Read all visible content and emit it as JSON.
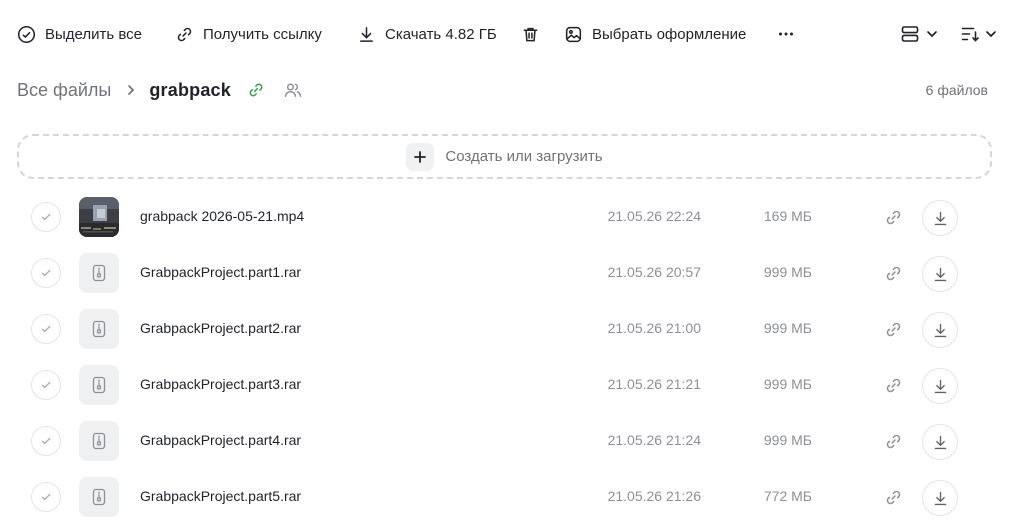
{
  "toolbar": {
    "select_all_label": "Выделить все",
    "get_link_label": "Получить ссылку",
    "download_label": "Скачать 4.82 ГБ",
    "choose_design_label": "Выбрать оформление"
  },
  "breadcrumb": {
    "root": "Все файлы",
    "current": "grabpack"
  },
  "file_count": "6 файлов",
  "upload": {
    "label": "Создать или загрузить"
  },
  "colors": {
    "accent_green": "#3aa04a",
    "text_primary": "#1f2328",
    "text_secondary": "#8c9096"
  },
  "files": [
    {
      "name": "grabpack 2026-05-21.mp4",
      "date": "21.05.26 22:24",
      "size": "169 МБ",
      "type": "video"
    },
    {
      "name": "GrabpackProject.part1.rar",
      "date": "21.05.26 20:57",
      "size": "999 МБ",
      "type": "archive"
    },
    {
      "name": "GrabpackProject.part2.rar",
      "date": "21.05.26 21:00",
      "size": "999 МБ",
      "type": "archive"
    },
    {
      "name": "GrabpackProject.part3.rar",
      "date": "21.05.26 21:21",
      "size": "999 МБ",
      "type": "archive"
    },
    {
      "name": "GrabpackProject.part4.rar",
      "date": "21.05.26 21:24",
      "size": "999 МБ",
      "type": "archive"
    },
    {
      "name": "GrabpackProject.part5.rar",
      "date": "21.05.26 21:26",
      "size": "772 МБ",
      "type": "archive"
    }
  ]
}
